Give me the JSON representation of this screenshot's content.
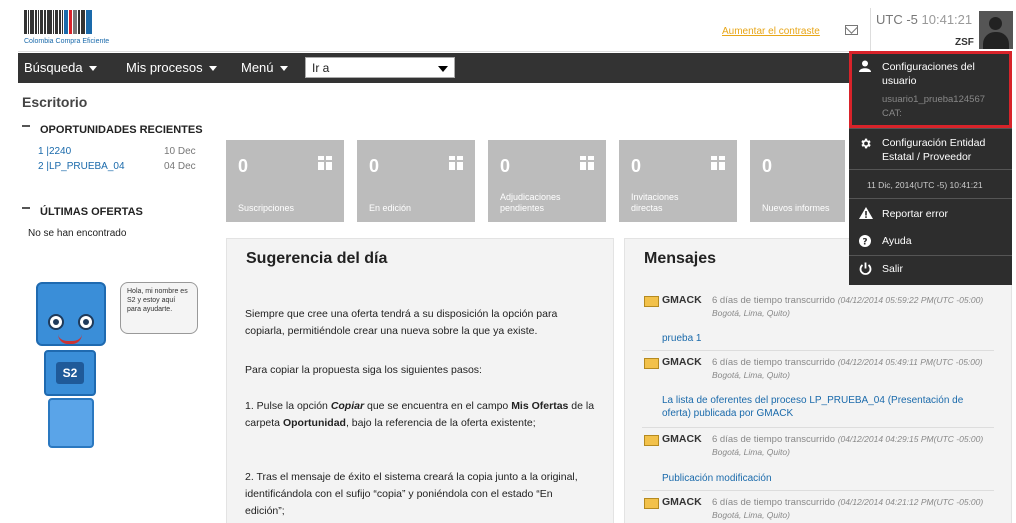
{
  "header": {
    "logo_text": "Colombia Compra Eficiente",
    "contrast_link": "Aumentar el contraste",
    "timezone": "UTC -5",
    "time": "10:41:21",
    "user_code": "ZSF"
  },
  "nav": {
    "items": [
      "Búsqueda",
      "Mis procesos",
      "Menú"
    ],
    "goto_value": "Ir a"
  },
  "sidebar": {
    "page_title": "Escritorio",
    "recent_heading": "OPORTUNIDADES RECIENTES",
    "recent": [
      {
        "label": "1 |2240",
        "date": "10 Dec"
      },
      {
        "label": "2 |LP_PRUEBA_04",
        "date": "04 Dec"
      }
    ],
    "offers_heading": "ÚLTIMAS OFERTAS",
    "no_results": "No se han encontrado",
    "mascot_bubble": "Hola, mi nombre es S2 y estoy aquí para ayudarte.",
    "mascot_badge": "S2"
  },
  "tiles": [
    {
      "value": "0",
      "label": "Suscripciones"
    },
    {
      "value": "0",
      "label": "En edición"
    },
    {
      "value": "0",
      "label": "Adjudicaciones pendientes"
    },
    {
      "value": "0",
      "label": "Invitaciones directas"
    },
    {
      "value": "0",
      "label": "Nuevos informes"
    }
  ],
  "tip": {
    "title": "Sugerencia del día",
    "p1": "Siempre que cree una oferta tendrá a su disposición la opción para copiarla, permitiéndole crear una nueva sobre la que ya existe.",
    "p2": "Para copiar la propuesta siga los siguientes pasos:",
    "p3_a": "1. Pulse la opción ",
    "p3_b": "Copiar",
    "p3_c": " que se encuentra en el campo ",
    "p3_d": "Mis Ofertas",
    "p3_e": " de la carpeta ",
    "p3_f": "Oportunidad",
    "p3_g": ", bajo la referencia de la oferta existente;",
    "p4": "2. Tras el mensaje de éxito el sistema creará la copia junto a la original, identificándola con el sufijo “copia” y poniéndola con el estado “En edición”;"
  },
  "messages": {
    "title": "Mensajes",
    "items": [
      {
        "sender": "GMACK",
        "elapsed": "6 días de tiempo transcurrido",
        "stamp": "(04/12/2014 05:59:22 PM(UTC -05:00) Bogotá, Lima, Quito)",
        "subject": "prueba 1"
      },
      {
        "sender": "GMACK",
        "elapsed": "6 días de tiempo transcurrido",
        "stamp": "(04/12/2014 05:49:11 PM(UTC -05:00) Bogotá, Lima, Quito)",
        "subject": "La lista de oferentes del proceso LP_PRUEBA_04 (Presentación de oferta) publicada por GMACK"
      },
      {
        "sender": "GMACK",
        "elapsed": "6 días de tiempo transcurrido",
        "stamp": "(04/12/2014 04:29:15 PM(UTC -05:00) Bogotá, Lima, Quito)",
        "subject": "Publicación modificación"
      },
      {
        "sender": "GMACK",
        "elapsed": "6 días de tiempo transcurrido",
        "stamp": "(04/12/2014 04:21:12 PM(UTC -05:00) Bogotá, Lima, Quito)",
        "subject": ""
      }
    ]
  },
  "user_menu": {
    "config_user": "Configuraciones del usuario",
    "username": "usuario1_prueba124567",
    "cat": "CAT:",
    "config_entity": "Configuración Entidad Estatal / Proveedor",
    "date_line": "11 Dic, 2014(UTC -5) 10:41:21",
    "report_error": "Reportar error",
    "help": "Ayuda",
    "logout": "Salir"
  },
  "colors": {
    "accent_link": "#1a6aab",
    "highlight": "#d8232a",
    "contrast_link": "#e8a617"
  }
}
